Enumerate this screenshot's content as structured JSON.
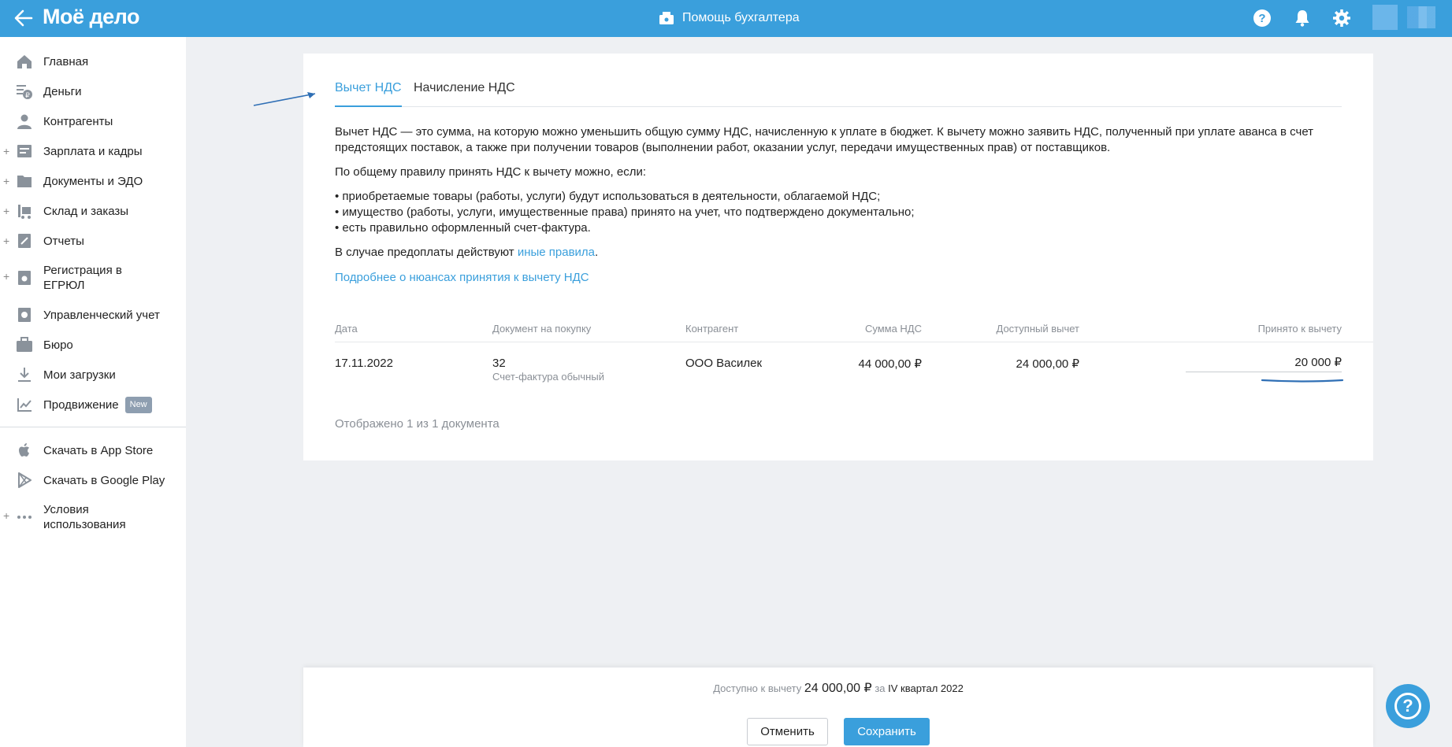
{
  "header": {
    "logo": "Моё дело",
    "helper_label": "Помощь бухгалтера"
  },
  "sidebar": {
    "items": [
      {
        "label": "Главная",
        "icon": "home-icon",
        "expandable": false
      },
      {
        "label": "Деньги",
        "icon": "money-icon",
        "expandable": false
      },
      {
        "label": "Контрагенты",
        "icon": "contractors-icon",
        "expandable": false
      },
      {
        "label": "Зарплата и кадры",
        "icon": "salary-icon",
        "expandable": true
      },
      {
        "label": "Документы и ЭДО",
        "icon": "documents-icon",
        "expandable": true
      },
      {
        "label": "Склад и заказы",
        "icon": "warehouse-icon",
        "expandable": true
      },
      {
        "label": "Отчеты",
        "icon": "reports-icon",
        "expandable": true
      },
      {
        "label": "Регистрация в ЕГРЮЛ",
        "icon": "registration-icon",
        "expandable": true
      },
      {
        "label": "Управленческий учет",
        "icon": "management-icon",
        "expandable": false
      },
      {
        "label": "Бюро",
        "icon": "briefcase-icon",
        "expandable": false
      },
      {
        "label": "Мои загрузки",
        "icon": "download-icon",
        "expandable": false
      },
      {
        "label": "Продвижение",
        "icon": "promotion-icon",
        "expandable": false,
        "badge": "New"
      }
    ],
    "bottom_items": [
      {
        "label": "Скачать в App Store",
        "icon": "apple-icon"
      },
      {
        "label": "Скачать в Google Play",
        "icon": "google-play-icon"
      },
      {
        "label": "Условия использования",
        "icon": "more-icon"
      }
    ]
  },
  "tabs": [
    {
      "label": "Вычет НДС",
      "active": true
    },
    {
      "label": "Начисление НДС",
      "active": false
    }
  ],
  "content": {
    "intro": "Вычет НДС — это сумма, на которую можно уменьшить общую сумму НДС, начисленную к уплате в бюджет. К вычету можно заявить НДС, полученный при уплате аванса в счет предстоящих поставок, а также при получении товаров (выполнении работ, оказании услуг, передачи имущественных прав) от поставщиков.",
    "rule_title": "По общему правилу принять НДС к вычету можно, если:",
    "bullets": [
      "• приобретаемые товары (работы, услуги) будут использоваться в деятельности, облагаемой НДС;",
      "• имущество (работы, услуги, имущественные права) принято на учет, что подтверждено документально;",
      "• есть правильно оформленный счет-фактура."
    ],
    "prepay_prefix": "В случае предоплаты действуют ",
    "prepay_link": "иные правила",
    "prepay_suffix": ".",
    "more_link": "Подробнее о нюансах принятия к вычету НДС"
  },
  "table": {
    "headers": [
      "Дата",
      "Документ на покупку",
      "Контрагент",
      "Сумма НДС",
      "Доступный вычет",
      "Принято к вычету"
    ],
    "rows": [
      {
        "date": "17.11.2022",
        "doc_number": "32",
        "doc_type": "Счет-фактура обычный",
        "contractor": "ООО Василек",
        "vat_sum": "44 000,00 ₽",
        "available": "24 000,00 ₽",
        "accepted": "20 000 ₽"
      }
    ],
    "footnote": "Отображено 1 из 1 документа"
  },
  "bottom": {
    "avail_prefix": "Доступно к вычету",
    "avail_amount": "24 000,00 ₽",
    "avail_mid": "за",
    "avail_quarter": "IV квартал 2022",
    "cancel": "Отменить",
    "save": "Сохранить"
  },
  "colors": {
    "brand": "#3a9fdc",
    "annotation": "#2f6fb5"
  }
}
